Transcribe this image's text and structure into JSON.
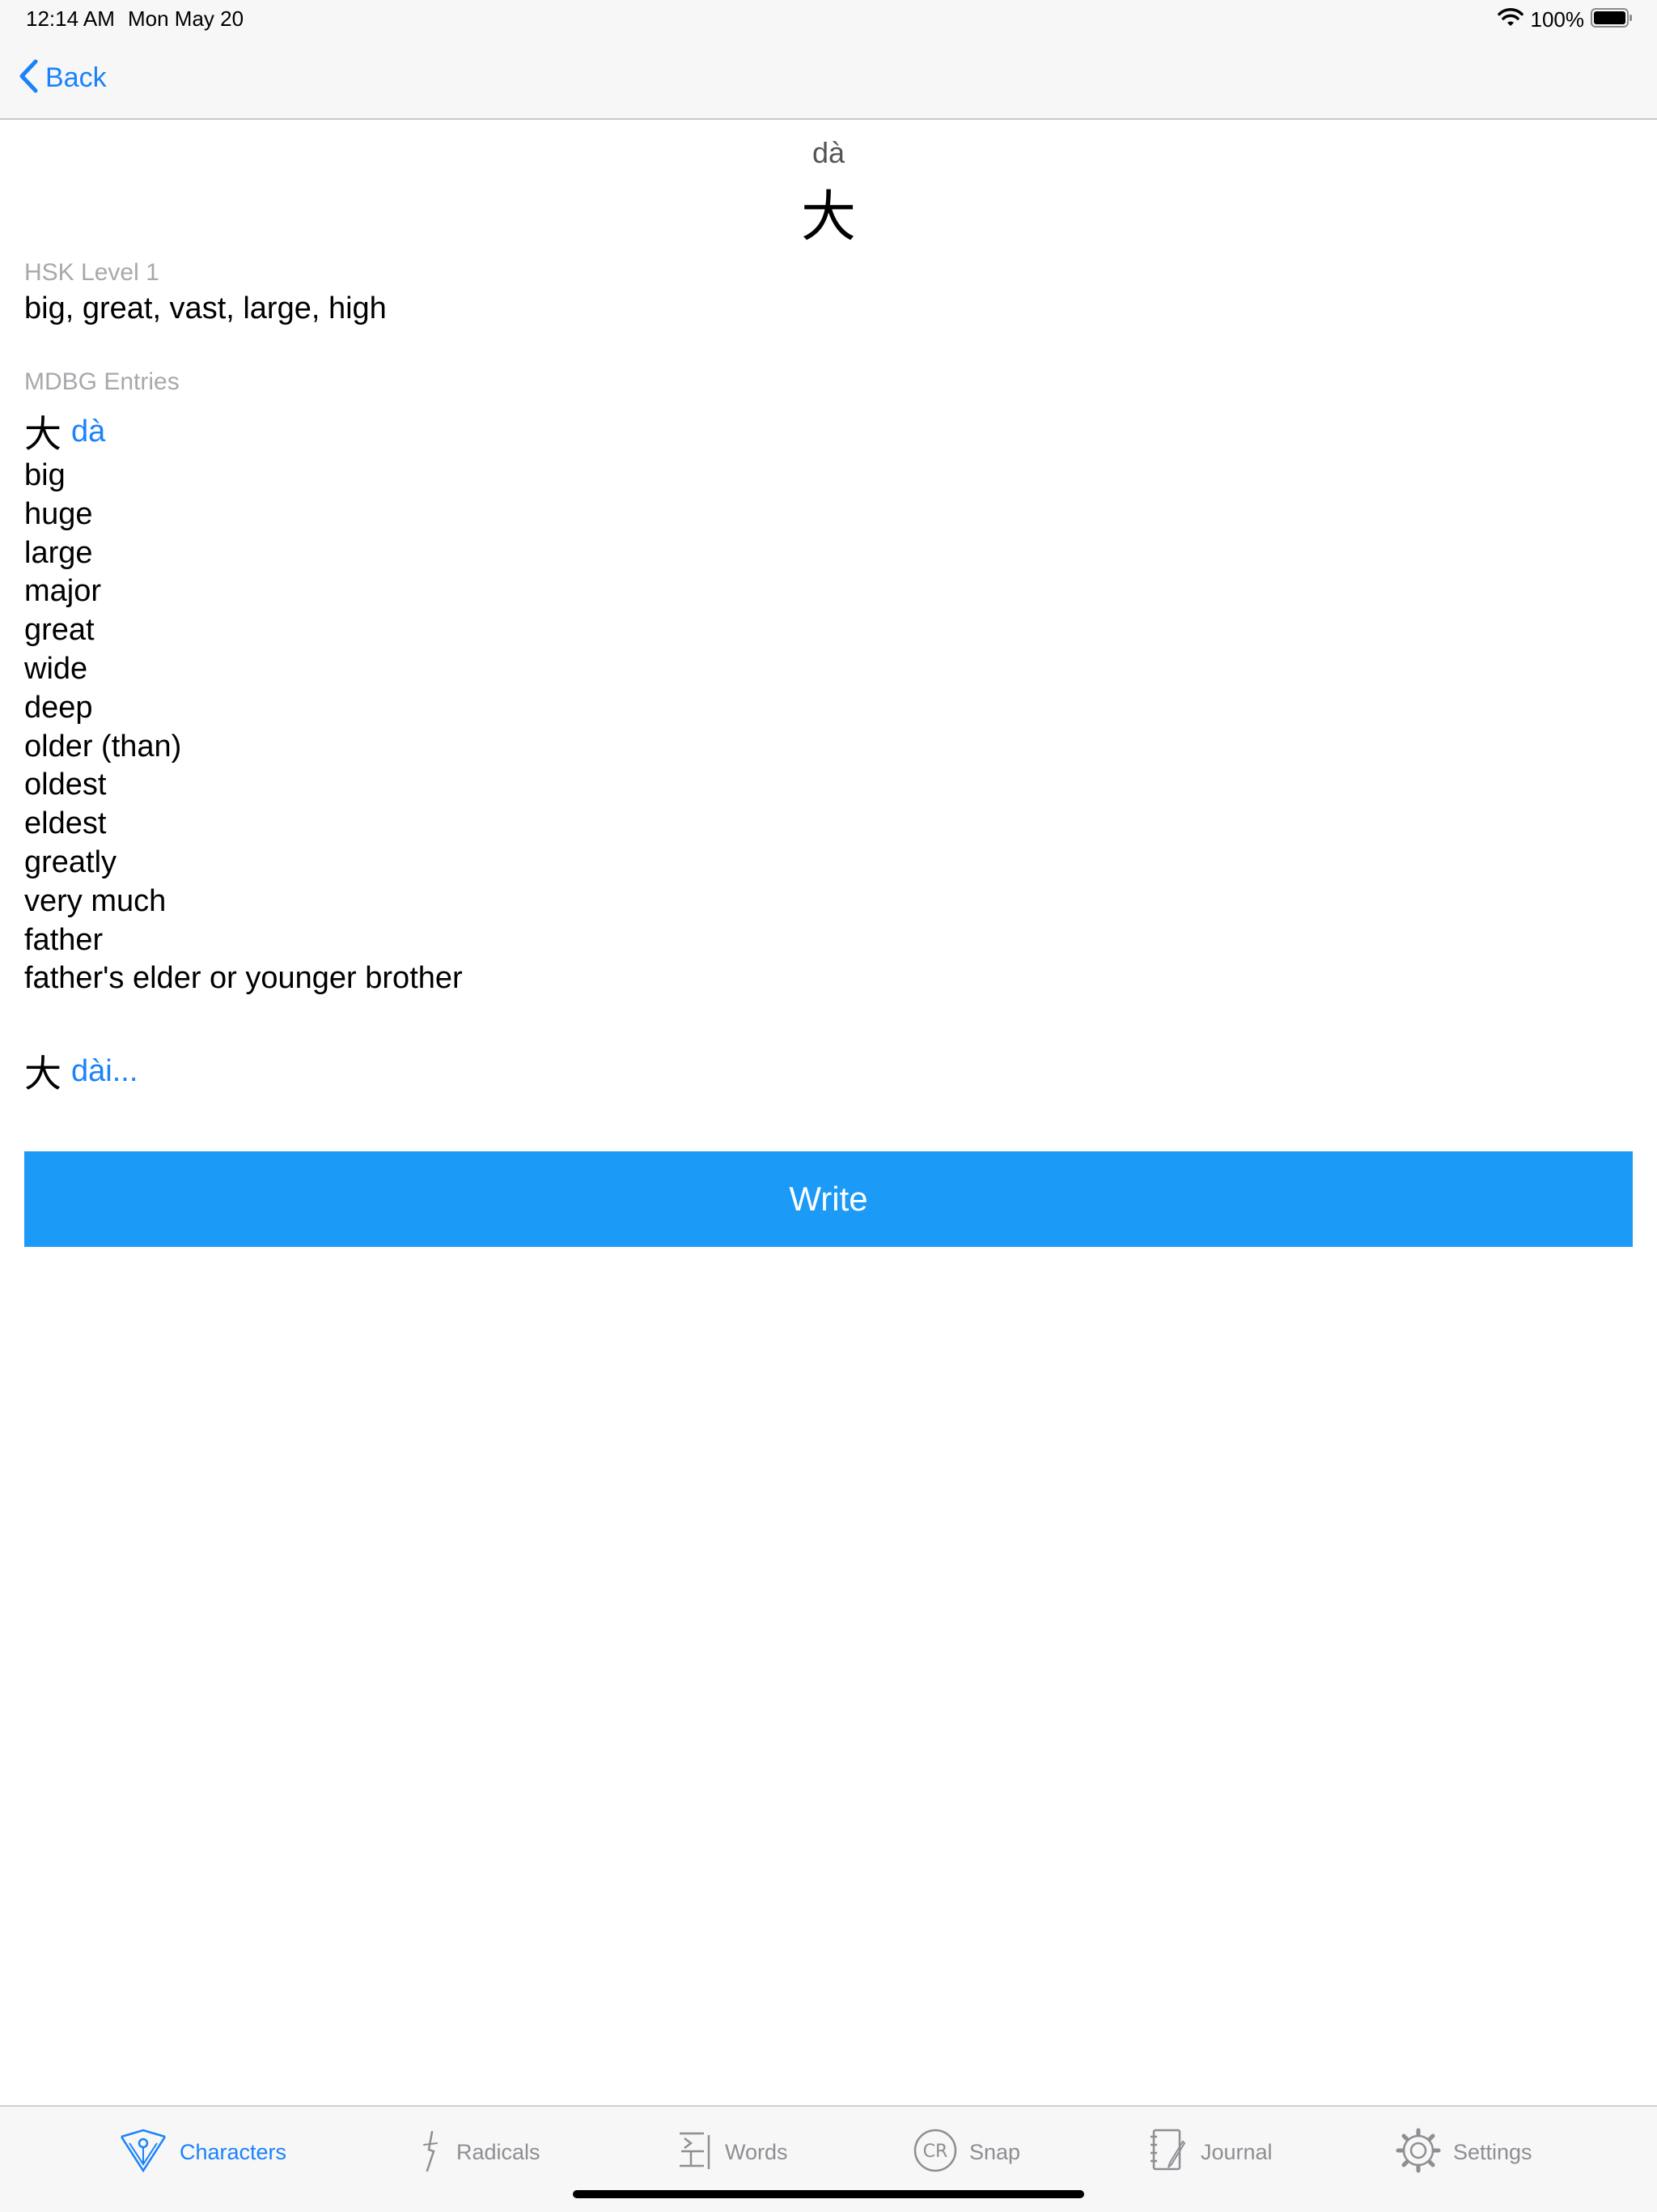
{
  "status_bar": {
    "time": "12:14 AM",
    "date": "Mon May 20",
    "battery": "100%"
  },
  "nav": {
    "back_label": "Back"
  },
  "header": {
    "pinyin": "dà",
    "character": "大"
  },
  "hsk": {
    "label": "HSK Level 1",
    "meaning": "big, great, vast, large, high"
  },
  "mdbg": {
    "label": "MDBG Entries",
    "entries": [
      {
        "character": "大",
        "pinyin": "dà",
        "definitions": [
          "big",
          "huge",
          "large",
          "major",
          "great",
          "wide",
          "deep",
          "older (than)",
          "oldest",
          "eldest",
          "greatly",
          "very much",
          "father",
          "father's elder or younger brother"
        ]
      },
      {
        "character": "大",
        "pinyin": "dài..."
      }
    ]
  },
  "write_button": {
    "label": "Write"
  },
  "tabs": [
    {
      "label": "Characters",
      "icon": "characters-icon",
      "active": true
    },
    {
      "label": "Radicals",
      "icon": "radicals-icon",
      "active": false
    },
    {
      "label": "Words",
      "icon": "words-icon",
      "active": false
    },
    {
      "label": "Snap",
      "icon": "snap-icon",
      "active": false
    },
    {
      "label": "Journal",
      "icon": "journal-icon",
      "active": false
    },
    {
      "label": "Settings",
      "icon": "settings-icon",
      "active": false
    }
  ],
  "colors": {
    "accent": "#1a82fb",
    "button": "#1b9af7",
    "secondary_text": "#a8a8ad",
    "bar_background": "#f7f7f7"
  }
}
